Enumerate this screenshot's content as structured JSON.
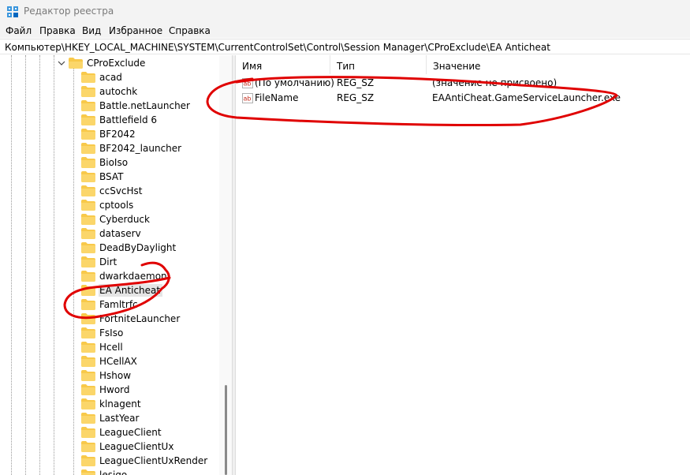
{
  "window": {
    "title": "Редактор реестра",
    "accent": "#0067c0"
  },
  "menu": {
    "items": [
      "Файл",
      "Правка",
      "Вид",
      "Избранное",
      "Справка"
    ]
  },
  "address": {
    "path": "Компьютер\\HKEY_LOCAL_MACHINE\\SYSTEM\\CurrentControlSet\\Control\\Session Manager\\CProExclude\\EA Anticheat"
  },
  "tree": {
    "parent": "CProExclude",
    "children": [
      "acad",
      "autochk",
      "Battle.netLauncher",
      "Battlefield 6",
      "BF2042",
      "BF2042_launcher",
      "BioIso",
      "BSAT",
      "ccSvcHst",
      "cptools",
      "Cyberduck",
      "dataserv",
      "DeadByDaylight",
      "Dirt",
      "dwarkdaemon",
      "EA Anticheat",
      "Famltrfc",
      "FortniteLauncher",
      "FsIso",
      "Hcell",
      "HCellAX",
      "Hshow",
      "Hword",
      "klnagent",
      "LastYear",
      "LeagueClient",
      "LeagueClientUx",
      "LeagueClientUxRender",
      "lesigo"
    ],
    "selected": "EA Anticheat",
    "folder_color": "#f8c94a"
  },
  "list": {
    "headers": {
      "name": "Имя",
      "type": "Тип",
      "value": "Значение"
    },
    "rows": [
      {
        "icon": "string-value-icon",
        "name": "(По умолчанию)",
        "type": "REG_SZ",
        "value": "(значение не присвоено)"
      },
      {
        "icon": "string-value-icon",
        "name": "FileName",
        "type": "REG_SZ",
        "value": "EAAntiCheat.GameServiceLauncher.exe"
      }
    ]
  },
  "annotation_color": "#e00000"
}
